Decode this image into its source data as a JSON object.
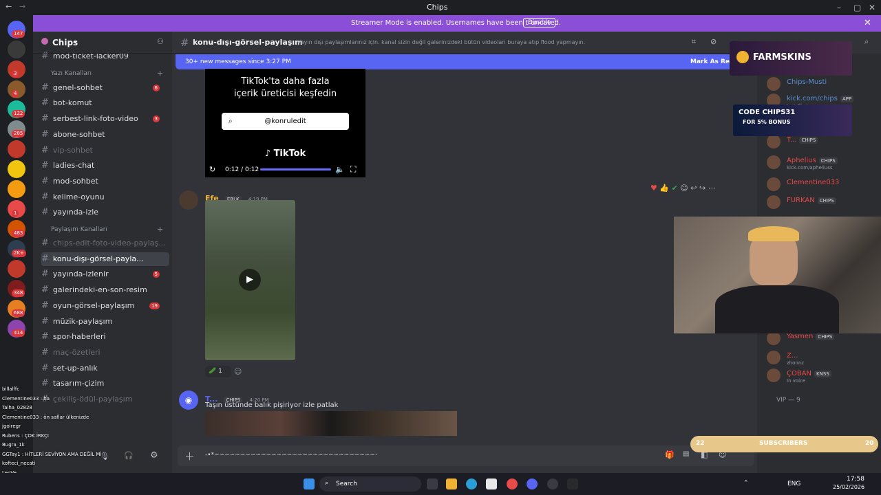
{
  "window": {
    "title": "Chips"
  },
  "banner": {
    "text": "Streamer Mode is enabled. Usernames have been truncated.",
    "button": "Disable"
  },
  "server": {
    "name": "Chips"
  },
  "servers": [
    {
      "icon": "discord-icon",
      "badge": "147"
    },
    {
      "icon": "server-icon",
      "badge": ""
    },
    {
      "icon": "server-icon",
      "badge": "3"
    },
    {
      "icon": "server-icon",
      "badge": "4"
    },
    {
      "icon": "server-icon",
      "badge": "122"
    },
    {
      "icon": "server-icon",
      "badge": "285"
    },
    {
      "icon": "server-icon",
      "badge": ""
    },
    {
      "icon": "server-icon",
      "badge": ""
    },
    {
      "icon": "server-icon",
      "badge": ""
    },
    {
      "icon": "server-icon",
      "badge": "1"
    },
    {
      "icon": "server-icon",
      "badge": "483"
    },
    {
      "icon": "server-icon",
      "badge": "2K+"
    },
    {
      "icon": "server-icon",
      "badge": ""
    },
    {
      "icon": "server-icon",
      "badge": "348"
    },
    {
      "icon": "server-icon",
      "badge": "688"
    },
    {
      "icon": "server-icon",
      "badge": "414"
    }
  ],
  "channels": {
    "top": [
      {
        "name": "mod-ticket-lacker09"
      }
    ],
    "category1": "Yazı Kanalları",
    "text": [
      {
        "name": "genel-sohbet",
        "badge": "6",
        "muted": false
      },
      {
        "name": "bot-komut",
        "badge": "",
        "muted": false
      },
      {
        "name": "serbest-link-foto-video",
        "badge": "3",
        "muted": false
      },
      {
        "name": "abone-sohbet",
        "badge": "",
        "muted": false
      },
      {
        "name": "vip-sohbet",
        "badge": "",
        "muted": true
      },
      {
        "name": "ladies-chat",
        "badge": "",
        "muted": false
      },
      {
        "name": "mod-sohbet",
        "badge": "",
        "muted": false
      },
      {
        "name": "kelime-oyunu",
        "badge": "",
        "muted": false
      },
      {
        "name": "yayında-izle",
        "badge": "",
        "muted": false
      }
    ],
    "category2": "Paylaşım Kanalları",
    "share": [
      {
        "name": "chips-edit-foto-video-paylaş...",
        "badge": "",
        "muted": true
      },
      {
        "name": "konu-dışı-görsel-payla...",
        "badge": "",
        "muted": false,
        "active": true
      },
      {
        "name": "yayında-izlenir",
        "badge": "5",
        "muted": false
      },
      {
        "name": "galerindeki-en-son-resim",
        "badge": "",
        "muted": false
      },
      {
        "name": "oyun-görsel-paylaşım",
        "badge": "19",
        "muted": false
      },
      {
        "name": "müzik-paylaşım",
        "badge": "",
        "muted": false
      },
      {
        "name": "spor-haberleri",
        "badge": "",
        "muted": false
      },
      {
        "name": "maç-özetleri",
        "badge": "",
        "muted": true
      },
      {
        "name": "set-up-anlık",
        "badge": "",
        "muted": false
      },
      {
        "name": "tasarım-çizim",
        "badge": "",
        "muted": false
      },
      {
        "name": "çekiliş-ödül-paylaşım",
        "badge": "",
        "muted": true
      }
    ]
  },
  "overlay_chat": [
    "billalffc",
    "Clementine033 : ha",
    "Talha_02828",
    "Clementine033 : ön saflar ülkenizde",
    "jgoiregr",
    "Rubens : ÇOK İRKÇI",
    "Bugra_1k",
    "GGTay1 : HİTLERİ SEVİYON AMA DEĞİL Mİ",
    "kofteci_necati",
    "LeoVe",
    "Cavalli97"
  ],
  "header": {
    "channel": "konu-dışı-görsel-paylaşım",
    "topic": "yayın dışı paylaşımlarınız için. kanal sizin değil galerinizdeki bütün videoları buraya atıp flood yapmayın."
  },
  "newbar": {
    "text": "30+ new messages since 3:27 PM",
    "action": "Mark As Read"
  },
  "tiktok": {
    "line1": "TikTok'ta daha fazla",
    "line2": "içerik üreticisi keşfedin",
    "handle": "@konruledit",
    "brand": "TikTok",
    "time": "0:12 / 0:12"
  },
  "messages": [
    {
      "author": "Efe",
      "tag": "ERLK",
      "time": "4:19 PM",
      "color": "#f0b232",
      "reaction_count": "1"
    },
    {
      "author": "T...",
      "tag": "CHIPS",
      "time": "4:20 PM",
      "color": "#5865f2",
      "text": "Taşın üstünde balık pişiriyor izle patlak"
    }
  ],
  "input": {
    "placeholder": "-•*~~~~~~~~~~~~~~~~~~~~~~~~~~~~~~~~~~~~~~~~~~~~~~~~~~~~~~~~~~~~~~~~~~~~~~~~~~~~~~~~~~~~~~~"
  },
  "members": [
    {
      "name": "Chips-Musti",
      "sub": "",
      "color": "#5b8dd6",
      "tag": ""
    },
    {
      "name": "kick.com/chips",
      "sub": "Just Chat",
      "color": "#5b8dd6",
      "tag": "APP"
    },
    {
      "name": "T...",
      "sub": "",
      "color": "#e84a4a",
      "tag": "CHIPS"
    },
    {
      "name": "Aphelius",
      "sub": "kick.com/apheliuss",
      "color": "#e84a4a",
      "tag": "CHIPS"
    },
    {
      "name": "Clementine033",
      "sub": "",
      "color": "#e84a4a",
      "tag": ""
    },
    {
      "name": "FURKAN",
      "sub": "",
      "color": "#e84a4a",
      "tag": "CHIPS"
    },
    {
      "name": "Yasmen",
      "sub": "",
      "color": "#e84a4a",
      "tag": "CHIPS"
    },
    {
      "name": "Z...",
      "sub": "zhonnz",
      "color": "#e84a4a",
      "tag": ""
    },
    {
      "name": "ÇOBAN",
      "sub": "In voice",
      "color": "#e84a4a",
      "tag": "KNSS"
    }
  ],
  "vip": {
    "label": "VIP — 9"
  },
  "overlays": {
    "farmskins": "FARMSKINS",
    "code_line1": "CODE CHIPS31",
    "code_line2": "FOR 5% BONUS",
    "subs_left": "22",
    "subs_label": "SUBSCRIBERS",
    "subs_right": "20"
  },
  "taskbar": {
    "search": "Search",
    "lang": "ENG",
    "time": "17:58",
    "date": "25/02/2026"
  }
}
